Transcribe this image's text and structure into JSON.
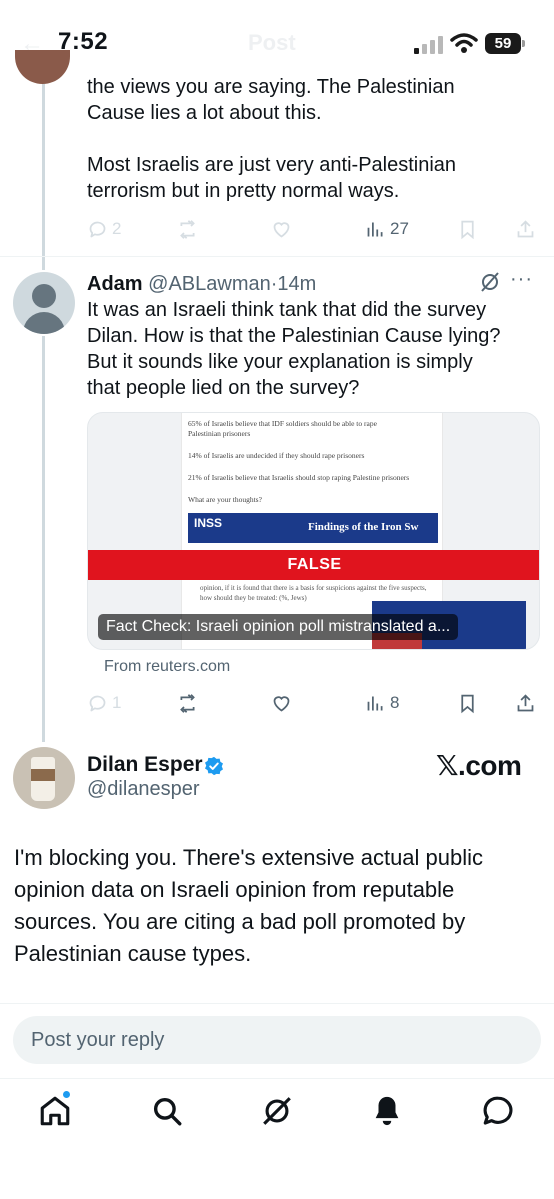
{
  "status_bar": {
    "time": "7:52",
    "battery": "59",
    "ghost_title": "Post",
    "ghost_back": "←"
  },
  "tweet1": {
    "text_lines": [
      "the views you are saying. The Palestinian",
      "Cause lies a lot about this.",
      "",
      "Most Israelis are just very anti-Palestinian",
      "terrorism but in pretty normal ways."
    ],
    "replies": "2",
    "views": "27"
  },
  "tweet2": {
    "name": "Adam",
    "handle": "@ABLawman",
    "separator": "·",
    "time": "14m",
    "text_lines": [
      "It was an Israeli think tank that did the survey",
      "Dilan. How is that the Palestinian Cause lying?",
      "But it sounds like your explanation is simply",
      "that people lied on the survey?"
    ],
    "card": {
      "doc_lines": [
        "65% of Israelis believe that IDF soldiers should be able to rape",
        "Palestinian prisoners",
        "14% of Israelis are undecided if they should rape prisoners",
        "21% of Israelis believe that Israelis should stop raping Palestine prisoners",
        "What are your thoughts?"
      ],
      "inss_logo": "INSS",
      "inss_heading": "Findings of the Iron Sw",
      "false_label": "FALSE",
      "doc_text": "opinion, if it is found that there is a basis for suspicions against the five suspects, how should they be treated: (%, Jews)",
      "caption": "Fact Check: Israeli opinion poll mistranslated a...",
      "source": "From reuters.com"
    },
    "replies": "1",
    "views": "8"
  },
  "main_tweet": {
    "name": "Dilan Esper",
    "handle": "@dilanesper",
    "watermark": "𝕏.com",
    "text_lines": [
      "I'm blocking you. There's extensive actual public",
      "opinion data on Israeli opinion from reputable",
      "sources. You are citing a bad poll promoted by",
      "Palestinian cause types."
    ]
  },
  "reply_box": {
    "placeholder": "Post your reply"
  },
  "nav": [
    "home-icon",
    "search-icon",
    "grok-icon",
    "notifications-icon",
    "messages-icon"
  ],
  "colors": {
    "accent": "#1d9bf0",
    "false_red": "#e0141e",
    "inss_blue": "#1b3a8a",
    "text_secondary": "#536471"
  }
}
